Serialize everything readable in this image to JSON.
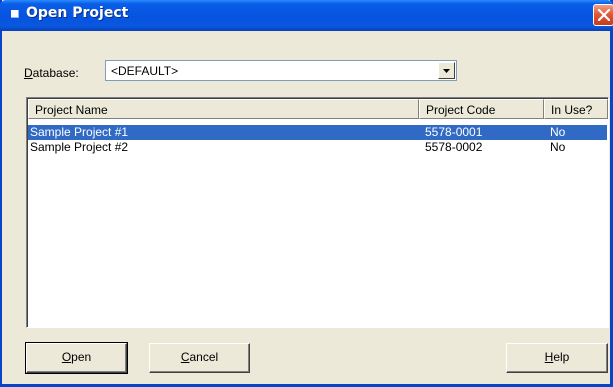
{
  "window": {
    "title": "Open Project",
    "title_icon": "window-icon",
    "close_icon": "close-icon",
    "accent": "#0a5ee8"
  },
  "database": {
    "label": "Database:",
    "value": "<DEFAULT>",
    "dropdown_icon": "chevron-down-icon"
  },
  "list": {
    "columns": [
      "Project Name",
      "Project Code",
      "In Use?"
    ],
    "rows": [
      {
        "name": "Sample Project #1",
        "code": "5578-0001",
        "in_use": "No",
        "selected": true
      },
      {
        "name": "Sample Project #2",
        "code": "5578-0002",
        "in_use": "No",
        "selected": false
      }
    ],
    "selection_color": "#316ac5"
  },
  "buttons": {
    "open": "Open",
    "cancel": "Cancel",
    "help": "Help"
  }
}
